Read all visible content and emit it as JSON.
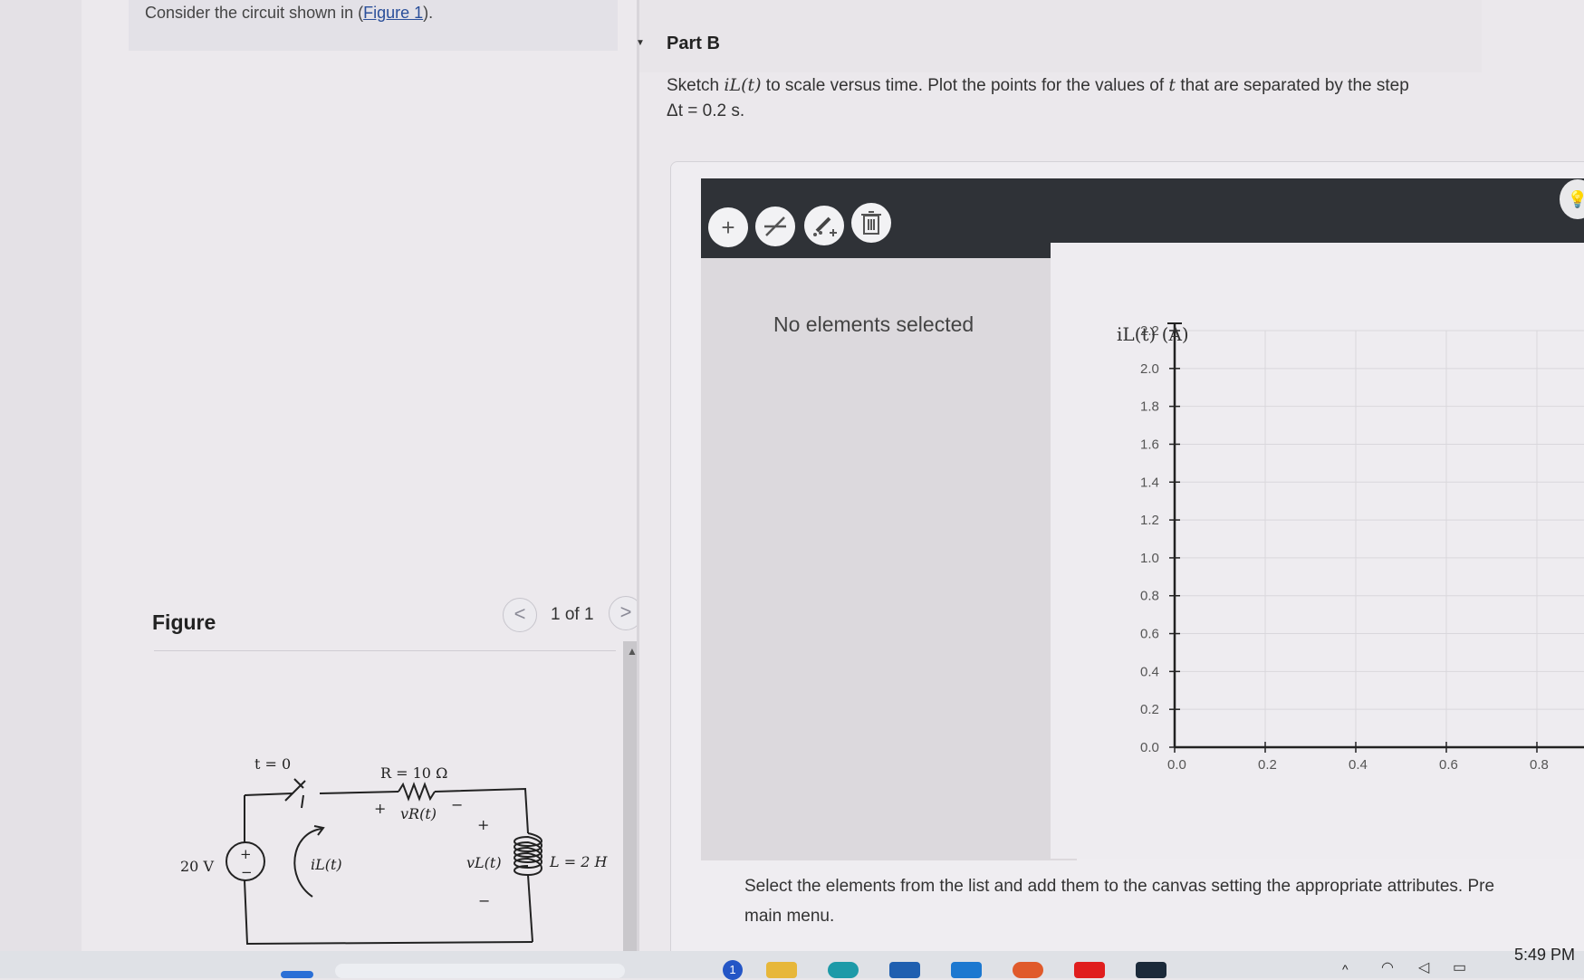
{
  "left_panel": {
    "intro_prefix": "Consider the circuit shown in (",
    "intro_link": "Figure 1",
    "intro_suffix": ").",
    "figure_title": "Figure",
    "pager": {
      "label": "1 of 1",
      "prev": "<",
      "next": ">"
    },
    "circuit": {
      "switch_label": "t = 0",
      "resistor_label": "R = 10 Ω",
      "vr_plus": "+",
      "vr_label": "vR(t)",
      "vr_minus": "−",
      "vl_plus": "+",
      "vl_label": "vL(t)",
      "vl_minus": "−",
      "source_label": "20 V",
      "source_plus": "+",
      "source_minus": "−",
      "current_label": "iL(t)",
      "inductor_label": "L = 2 H"
    }
  },
  "right_panel": {
    "part_title": "Part B",
    "prompt_a": "Sketch ",
    "prompt_sym": "iL(t)",
    "prompt_b": " to scale versus time. Plot the points for the values of ",
    "prompt_t": "t",
    "prompt_c": " that are separated by the step",
    "prompt_step": "Δt = 0.2 s.",
    "sidebar_message": "No elements selected",
    "instructions_line1": "Select the elements from the list and add them to the canvas setting the appropriate attributes. Pre",
    "instructions_line2": "main menu."
  },
  "toolbar": {
    "add_icon": "plus-icon",
    "line_icon": "line-slash-icon",
    "point_icon": "point-plus-icon",
    "delete_icon": "trash-icon",
    "hint_icon": "lightbulb-icon"
  },
  "chart_data": {
    "type": "scatter",
    "ylabel": "iL(t) (A)",
    "xlabel": "",
    "yticks": [
      0.0,
      0.2,
      0.4,
      0.6,
      0.8,
      1.0,
      1.2,
      1.4,
      1.6,
      1.8,
      2.0,
      2.2
    ],
    "ytick_labels": [
      "0.0",
      "0.2",
      "0.4",
      "0.6",
      "0.8",
      "1.0",
      "1.2",
      "1.4",
      "1.6",
      "1.8",
      "2.0",
      "2.2"
    ],
    "xticks": [
      0.0,
      0.2,
      0.4,
      0.6,
      0.8
    ],
    "xtick_labels": [
      "0.0",
      "0.2",
      "0.4",
      "0.6",
      "0.8"
    ],
    "ylim": [
      0,
      2.2
    ],
    "xlim": [
      0,
      0.8
    ],
    "grid": true,
    "series": []
  },
  "taskbar": {
    "clock": "5:49 PM",
    "badge_count": "1"
  },
  "colors": {
    "toolbar_bg": "#2f3237",
    "link": "#2a4f9a"
  }
}
